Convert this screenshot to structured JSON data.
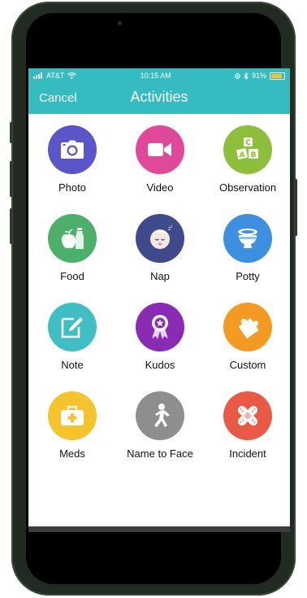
{
  "status": {
    "carrier": "AT&T",
    "time": "10:15 AM",
    "battery": "91%"
  },
  "nav": {
    "cancel_label": "Cancel",
    "title": "Activities"
  },
  "activities": [
    {
      "label": "Photo",
      "color": "#5a55c8",
      "icon": "camera-icon"
    },
    {
      "label": "Video",
      "color": "#e0489a",
      "icon": "video-camera-icon"
    },
    {
      "label": "Observation",
      "color": "#8dbe3c",
      "icon": "abc-blocks-icon"
    },
    {
      "label": "Food",
      "color": "#4caf6a",
      "icon": "apple-bottle-icon"
    },
    {
      "label": "Nap",
      "color": "#3e4a8a",
      "icon": "sleeping-baby-icon"
    },
    {
      "label": "Potty",
      "color": "#3d8fe0",
      "icon": "potty-icon"
    },
    {
      "label": "Note",
      "color": "#3fbfc4",
      "icon": "note-pencil-icon"
    },
    {
      "label": "Kudos",
      "color": "#8a2bb4",
      "icon": "award-ribbon-icon"
    },
    {
      "label": "Custom",
      "color": "#f39a22",
      "icon": "puzzle-piece-icon"
    },
    {
      "label": "Meds",
      "color": "#f5c32c",
      "icon": "medical-kit-icon"
    },
    {
      "label": "Name to Face",
      "color": "#8e8e8e",
      "icon": "running-person-icon"
    },
    {
      "label": "Incident",
      "color": "#e85a45",
      "icon": "bandage-icon"
    }
  ]
}
